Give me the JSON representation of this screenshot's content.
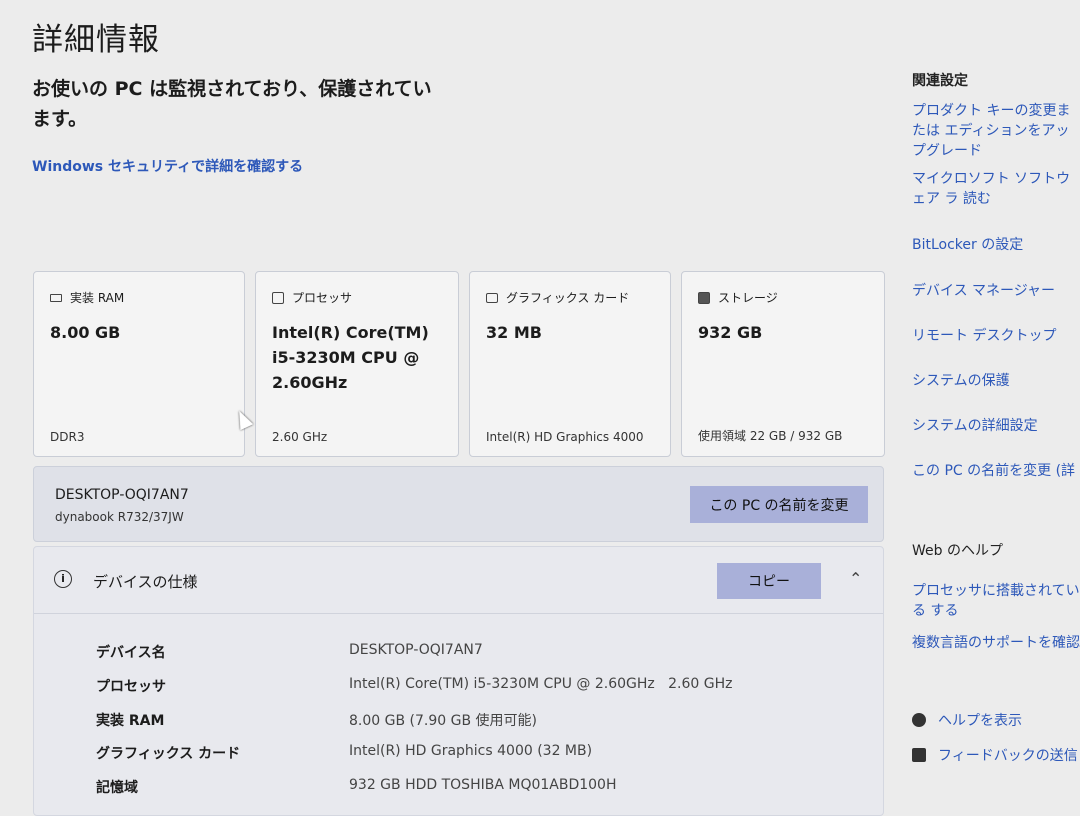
{
  "page": {
    "title": "詳細情報",
    "monitor_message": "お使いの PC は監視されており、保護されています。",
    "security_link": "Windows セキュリティで詳細を確認する"
  },
  "cards": [
    {
      "icon": "ram-icon",
      "label": "実装 RAM",
      "value": "8.00 GB",
      "sub": "DDR3"
    },
    {
      "icon": "processor-icon",
      "label": "プロセッサ",
      "value": "Intel(R) Core(TM) i5-3230M CPU @ 2.60GHz",
      "sub": "2.60 GHz"
    },
    {
      "icon": "graphics-card-icon",
      "label": "グラフィックス カード",
      "value": "32 MB",
      "sub": "Intel(R) HD Graphics 4000"
    },
    {
      "icon": "storage-icon",
      "label": "ストレージ",
      "value": "932 GB",
      "sub": "使用領域 22 GB / 932 GB"
    }
  ],
  "pc": {
    "name": "DESKTOP-OQI7AN7",
    "model": "dynabook R732/37JW",
    "rename_button": "この PC の名前を変更"
  },
  "specs": {
    "title": "デバイスの仕様",
    "copy_button": "コピー",
    "rows": [
      {
        "label": "デバイス名",
        "value": "DESKTOP-OQI7AN7"
      },
      {
        "label": "プロセッサ",
        "value": "Intel(R) Core(TM) i5-3230M CPU @ 2.60GHz   2.60 GHz"
      },
      {
        "label": "実装 RAM",
        "value": "8.00 GB (7.90 GB 使用可能)"
      },
      {
        "label": "グラフィックス カード",
        "value": "Intel(R) HD Graphics 4000 (32 MB)"
      },
      {
        "label": "記憶域",
        "value": "932 GB HDD TOSHIBA MQ01ABD100H"
      }
    ]
  },
  "related": {
    "heading": "関連設定",
    "links": [
      "プロダクト キーの変更または エディションをアップグレード",
      "マイクロソフト ソフトウェア ラ 読む",
      "BitLocker の設定",
      "デバイス マネージャー",
      "リモート デスクトップ",
      "システムの保護",
      "システムの詳細設定",
      "この PC の名前を変更 (詳"
    ]
  },
  "web_help": {
    "heading": "Web のヘルプ",
    "links": [
      "プロセッサに搭載されている する",
      "複数言語のサポートを確認"
    ]
  },
  "help": {
    "show_help": "ヘルプを表示",
    "feedback": "フィードバックの送信"
  },
  "colors": {
    "link": "#2d58b9",
    "button": "#a9b0d9",
    "background": "#ececec"
  }
}
